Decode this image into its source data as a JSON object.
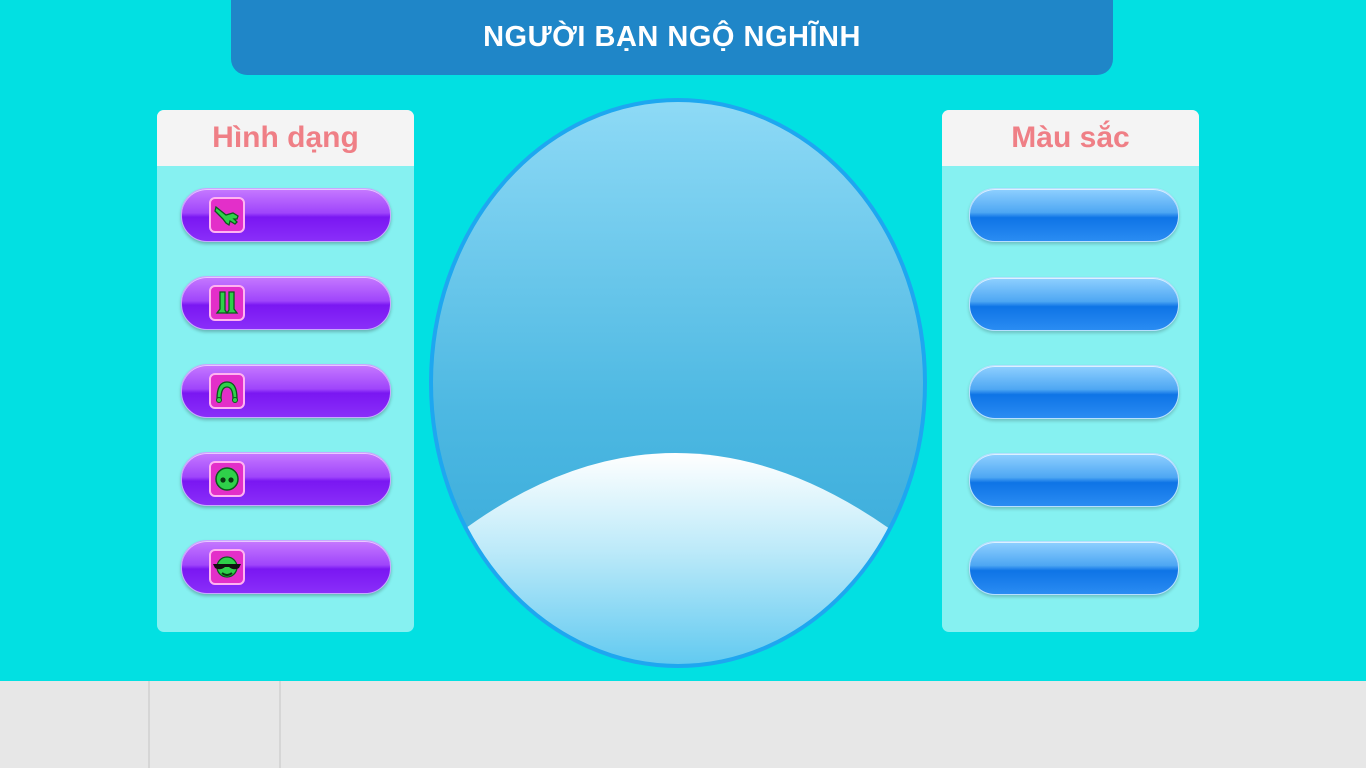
{
  "title": "NGƯỜI BẠN NGỘ NGHĨNH",
  "shape_panel": {
    "heading": "Hình dạng",
    "buttons": [
      {
        "icon": "hand-icon"
      },
      {
        "icon": "legs-icon"
      },
      {
        "icon": "hair-icon"
      },
      {
        "icon": "face-icon"
      },
      {
        "icon": "mouth-glasses-icon"
      }
    ]
  },
  "color_panel": {
    "heading": "Màu sắc",
    "button_count": 5
  },
  "colors": {
    "background": "#02e0e2",
    "title_bar": "#1f86c8",
    "heading_text": "#ef7f86",
    "shape_button": "#8a2ef9",
    "color_button": "#2a8cf2",
    "icon_bg": "#e32fc9",
    "icon_figure": "#2fd04a"
  }
}
